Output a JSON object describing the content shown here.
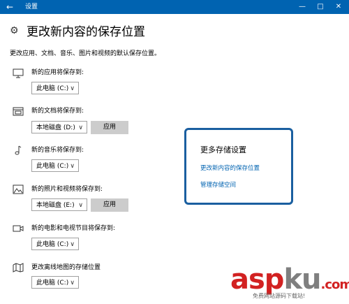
{
  "window": {
    "title": "设置"
  },
  "page": {
    "title": "更改新内容的保存位置",
    "description": "更改应用、文档、音乐、图片和视频的默认保存位置。"
  },
  "rows": [
    {
      "icon": "monitor-icon",
      "label": "新的应用将保存到:",
      "selected": "此电脑 (C:)",
      "apply": null
    },
    {
      "icon": "folder-icon",
      "label": "新的文档将保存到:",
      "selected": "本地磁盘 (D:)",
      "apply": "应用"
    },
    {
      "icon": "music-note-icon",
      "label": "新的音乐将保存到:",
      "selected": "此电脑 (C:)",
      "apply": null
    },
    {
      "icon": "image-icon",
      "label": "新的照片和视频将保存到:",
      "selected": "本地磁盘 (E:)",
      "apply": "应用"
    },
    {
      "icon": "video-camera-icon",
      "label": "新的电影和电视节目将保存到:",
      "selected": "此电脑 (C:)",
      "apply": null
    },
    {
      "icon": "map-icon",
      "label": "更改离线地图的存储位置",
      "selected": "此电脑 (C:)",
      "apply": null
    }
  ],
  "more_storage": {
    "title": "更多存储设置",
    "links": [
      "更改新内容的保存位置",
      "管理存储空间"
    ]
  },
  "watermark": {
    "text_a": "asp",
    "text_ku": "ku",
    "text_net": ".com",
    "sub": "免费网站源码下载站!"
  },
  "colors": {
    "titlebar": "#0063b1",
    "link": "#0063b1",
    "highlight_border": "#1a5fa0",
    "watermark_red": "#d22121"
  }
}
